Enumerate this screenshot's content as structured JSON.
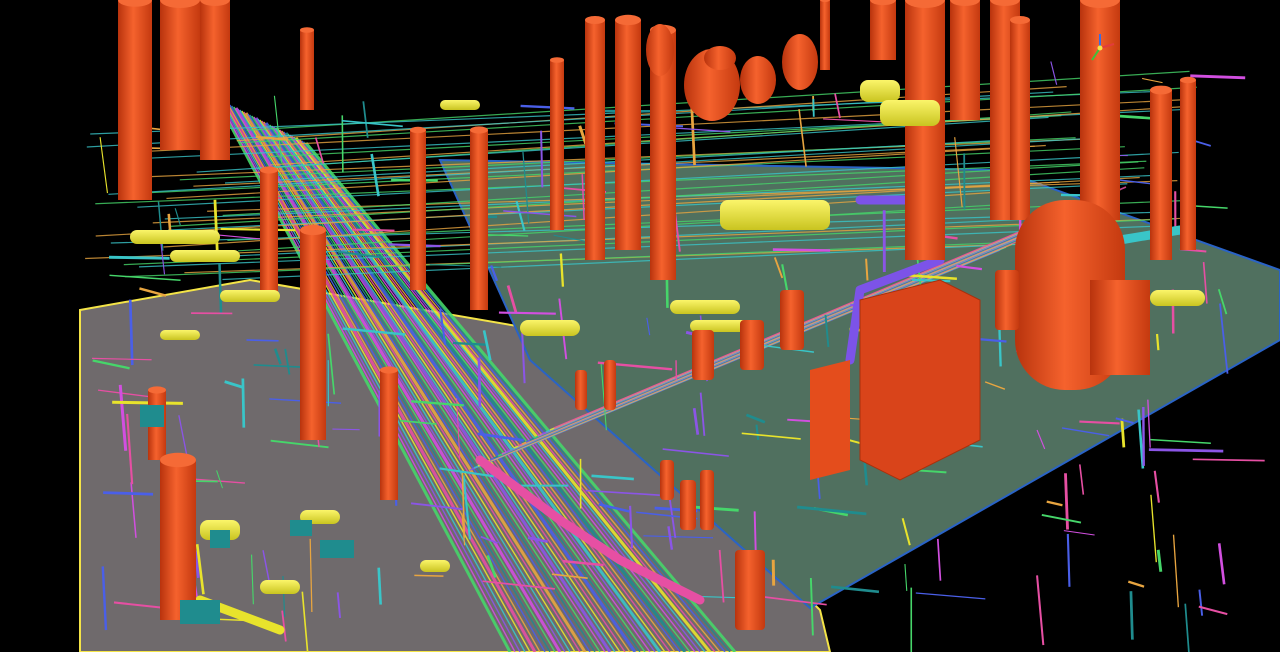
{
  "viewport": {
    "background": "#000000",
    "view": "3d-plant-model",
    "ground_left_color": "#6f6a6c",
    "ground_right_color": "#50705f",
    "edge_yellow": "#f4e447",
    "edge_blue": "#2a63c6"
  },
  "palette": {
    "vessel": "#ec4d1b",
    "vessel_dark": "#b8330d",
    "yellow": "#e8e32c",
    "green": "#46d66a",
    "magenta": "#d24fe0",
    "purple": "#8b55e6",
    "cyan": "#39c5c8",
    "teal": "#1f8c8e",
    "pink": "#e64fa3",
    "orange": "#e8a540",
    "blue": "#4a5fe8"
  },
  "gizmo": {
    "icon": "orientation-axes-icon"
  }
}
